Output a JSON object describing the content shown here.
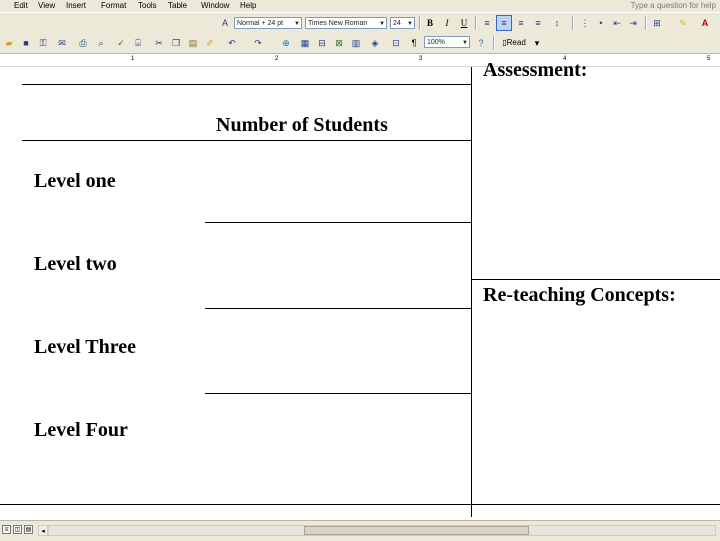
{
  "menu": {
    "items": [
      "Edit",
      "View",
      "Insert",
      "Format",
      "Tools",
      "Table",
      "Window",
      "Help"
    ],
    "help_box": "Type a question for help"
  },
  "format_toolbar": {
    "style": "Normal + 24 pt",
    "font": "Times New Roman",
    "size": "24",
    "bold": "B",
    "italic": "I",
    "underline": "U"
  },
  "standard_toolbar": {
    "zoom": "100%",
    "read_label": "Read",
    "pilcrow": "¶"
  },
  "ruler": {
    "marks": [
      "1",
      "2",
      "3",
      "4",
      "5"
    ]
  },
  "document": {
    "heading_top_right": "Assessment:",
    "heading_number_of_students": "Number of Students",
    "levels": [
      "Level one",
      "Level two",
      "Level Three",
      "Level Four"
    ],
    "heading_reteaching": "Re-teaching Concepts:"
  }
}
